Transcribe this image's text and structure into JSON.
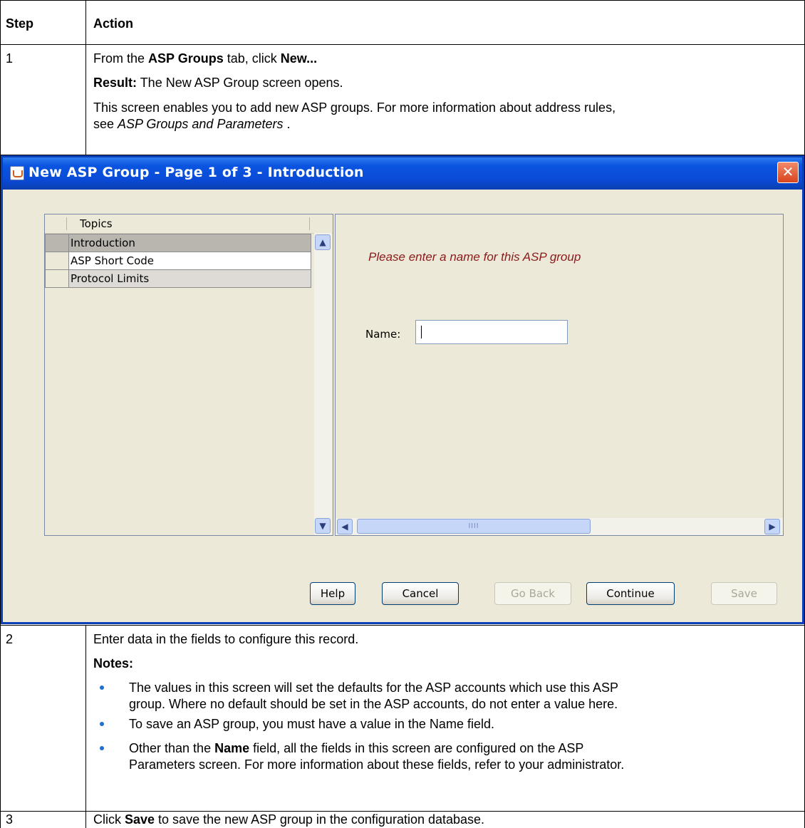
{
  "table": {
    "header": {
      "step": "Step",
      "action": "Action"
    },
    "rows": [
      {
        "step": "1",
        "line1_pre": "From the ",
        "line1_b1": "ASP Groups",
        "line1_mid": " tab, click ",
        "line1_b2": "New...",
        "result_label": "Result:",
        "result_text": " The New ASP Group screen opens.",
        "para_a": "This screen enables you to add new ASP groups. For more information about address rules,",
        "para_b_pre": "see ",
        "para_b_link": "ASP Groups and Parameters",
        "para_b_post": " ."
      },
      {
        "step": "2",
        "line1": "Enter data in the fields to configure this record.",
        "notes_label": "Notes:",
        "bullets": [
          {
            "a": "The values in this screen will set the defaults for the ASP accounts which use this ASP",
            "b": "group. Where no default should be set in the ASP accounts, do not enter a value here."
          },
          {
            "a": "To save an ASP group, you must have a value in the Name field."
          },
          {
            "a_pre": "Other than the ",
            "a_bold": "Name",
            "a_post": " field, all the fields in this screen are configured on the ASP",
            "b": "Parameters screen. For more information about these fields, refer to your administrator."
          }
        ]
      },
      {
        "step": "3",
        "pre": "Click ",
        "bold": "Save",
        "post": " to save the new ASP group in the configuration database."
      }
    ]
  },
  "dialog": {
    "title": "New ASP Group - Page 1 of 3 - Introduction",
    "close_glyph": "✕",
    "topics_header": "Topics",
    "topics": [
      "Introduction",
      "ASP Short Code",
      "Protocol Limits"
    ],
    "selected_topic": "Introduction",
    "prompt": "Please enter a name for this ASP group",
    "name_label": "Name:",
    "name_value": "",
    "scroll_thumb_grip": "IIII",
    "buttons": {
      "help": "Help",
      "cancel": "Cancel",
      "go_back": "Go Back",
      "continue": "Continue",
      "save": "Save"
    }
  },
  "colors": {
    "titlebar": "#0a4ad6",
    "dialog_bg": "#ece9d8",
    "prompt": "#8b1a1a",
    "bullet": "#1f6fd1"
  }
}
